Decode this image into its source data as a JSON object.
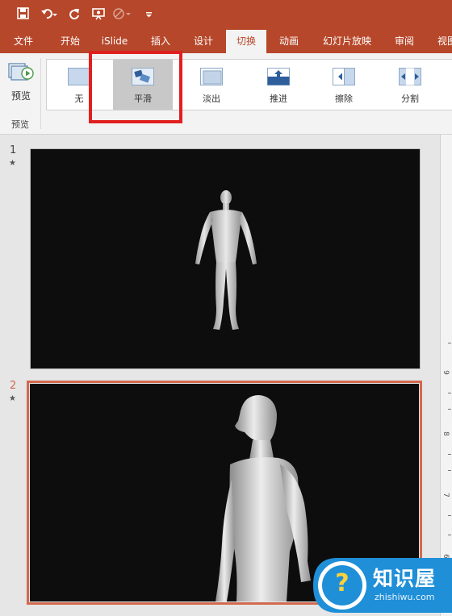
{
  "tabs": [
    "文件",
    "开始",
    "iSlide",
    "插入",
    "设计",
    "切换",
    "动画",
    "幻灯片放映",
    "审阅",
    "视图"
  ],
  "active_tab": "切换",
  "preview": {
    "button_label": "预览",
    "group_label": "预览"
  },
  "transitions": [
    {
      "label": "无",
      "icon": "none-transition-icon"
    },
    {
      "label": "平滑",
      "icon": "morph-transition-icon",
      "selected": true
    },
    {
      "label": "淡出",
      "icon": "fade-transition-icon"
    },
    {
      "label": "推进",
      "icon": "push-transition-icon"
    },
    {
      "label": "擦除",
      "icon": "wipe-transition-icon"
    },
    {
      "label": "分割",
      "icon": "split-transition-icon"
    }
  ],
  "slides": [
    {
      "number": "1",
      "star": "★"
    },
    {
      "number": "2",
      "star": "★",
      "selected": true
    }
  ],
  "ruler_numbers": [
    "9",
    "8",
    "7",
    "6"
  ],
  "watermark": {
    "title": "知识屋",
    "url": "zhishiwu.com",
    "badge": "?"
  },
  "colors": {
    "ribbon": "#b7472a",
    "selection_border": "#d2694f",
    "highlight_box": "#e02020",
    "watermark_blue": "#1f8fd8"
  },
  "icons": [
    "save-icon",
    "undo-icon",
    "redo-icon",
    "present-icon",
    "touch-mode-icon",
    "customize-qat-icon"
  ]
}
